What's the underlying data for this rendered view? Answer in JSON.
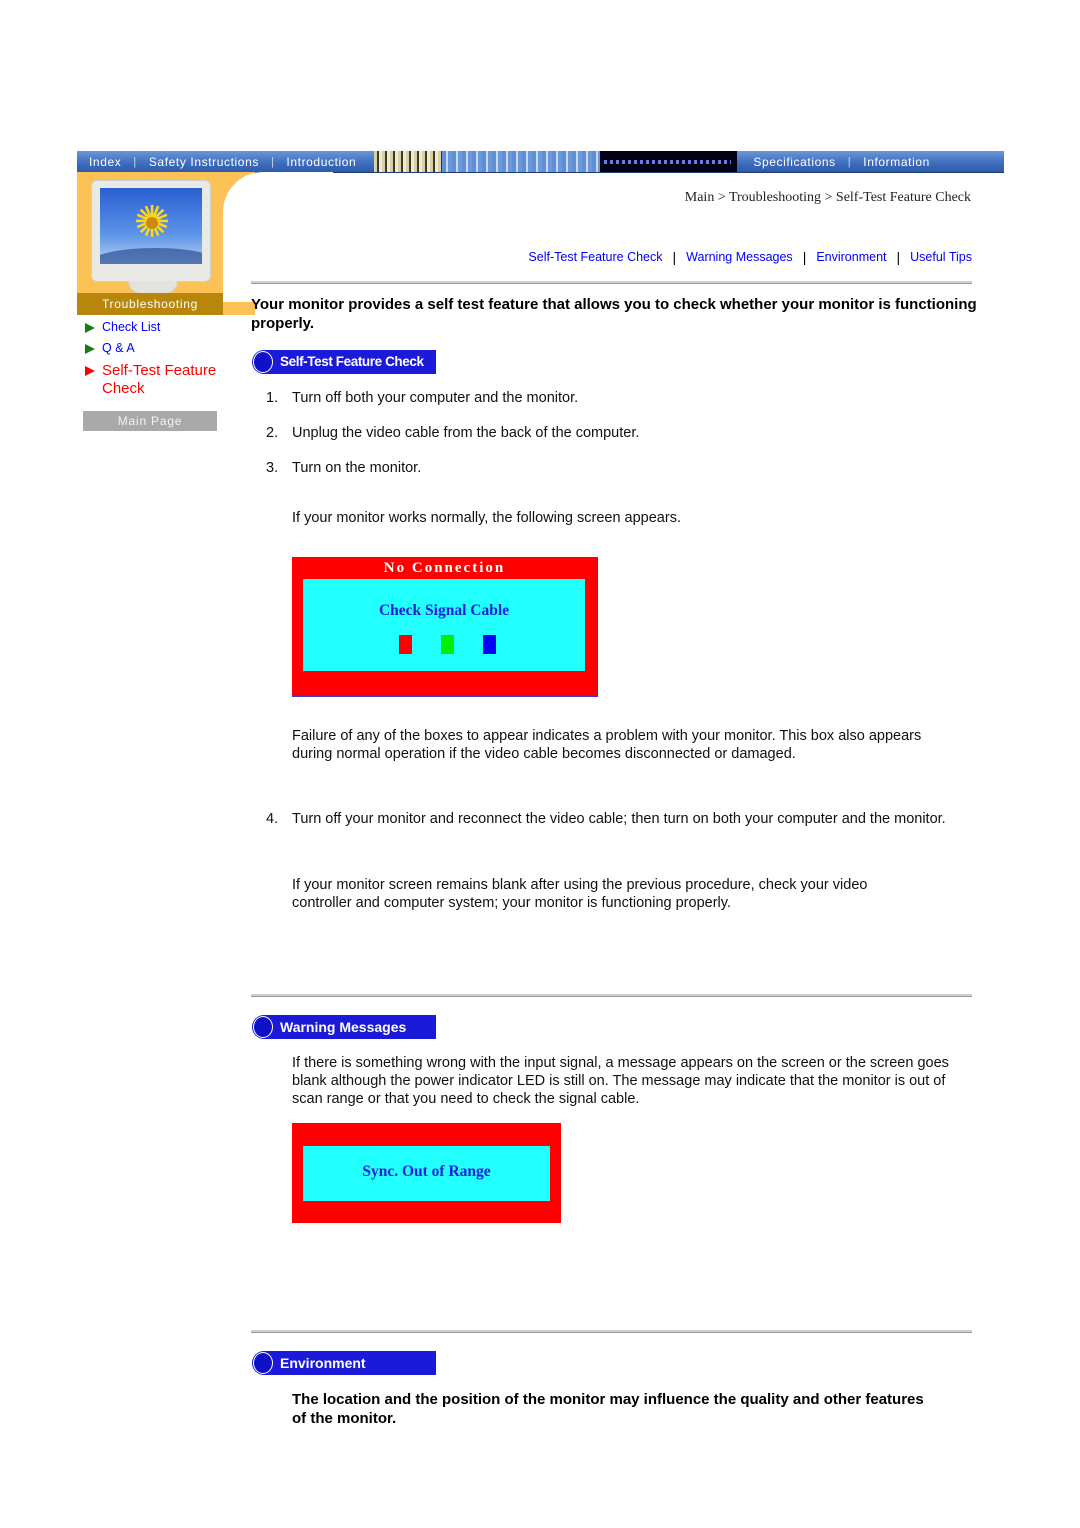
{
  "nav": {
    "tabs": [
      "Index",
      "Safety Instructions",
      "Introduction",
      "Specifications",
      "Information"
    ],
    "separator": "|"
  },
  "sidebar": {
    "section_label": "Troubleshooting",
    "links": [
      {
        "label": "Check List",
        "active": false
      },
      {
        "label": "Q & A",
        "active": false
      },
      {
        "label": "Self-Test Feature Check",
        "active": true
      }
    ],
    "main_page_button": "Main Page"
  },
  "breadcrumb": "Main > Troubleshooting > Self-Test Feature Check",
  "subnav": {
    "links": [
      "Self-Test Feature Check",
      "Warning Messages",
      "Environment",
      "Useful Tips"
    ],
    "separator": "|"
  },
  "intro": "Your monitor provides a self test feature that allows you to check whether your monitor is functioning properly.",
  "sections": {
    "self_test": {
      "title": "Self-Test Feature Check",
      "steps": [
        {
          "num": "1.",
          "text": "Turn off both your computer and the monitor."
        },
        {
          "num": "2.",
          "text": "Unplug the video cable from the back of the computer."
        },
        {
          "num": "3.",
          "text": "Turn on the monitor."
        }
      ],
      "note_after_step3": "If your monitor works normally, the following screen appears.",
      "screen": {
        "title": "No Connection",
        "message": "Check Signal Cable",
        "squares": [
          "#ff0000",
          "#00ee00",
          "#0000ff"
        ]
      },
      "failure_note": "Failure of any of the boxes to appear indicates a problem with your monitor. This box also appears during normal operation if the video cable becomes disconnected or damaged.",
      "step4": {
        "num": "4.",
        "text": "Turn off your monitor and reconnect the video cable; then turn on both your computer and the monitor."
      },
      "final_note": "If your monitor screen remains blank after using the previous procedure, check your video controller and computer system; your monitor is functioning properly."
    },
    "warning": {
      "title": "Warning Messages",
      "text": "If there is something wrong with the input signal, a message appears on the screen or the screen goes blank although the power indicator LED is still on. The message may indicate that the monitor is out of scan range or that you need to check the signal cable.",
      "screen": {
        "message": "Sync. Out of Range"
      }
    },
    "environment": {
      "title": "Environment",
      "text": "The location and the position of the monitor may influence the quality and other features of the monitor."
    }
  },
  "colors": {
    "link": "#0000ff",
    "active_link": "#ff0000",
    "badge": "#1a1ad8",
    "osd_red": "#ff0000",
    "osd_cyan": "#22ffff"
  }
}
